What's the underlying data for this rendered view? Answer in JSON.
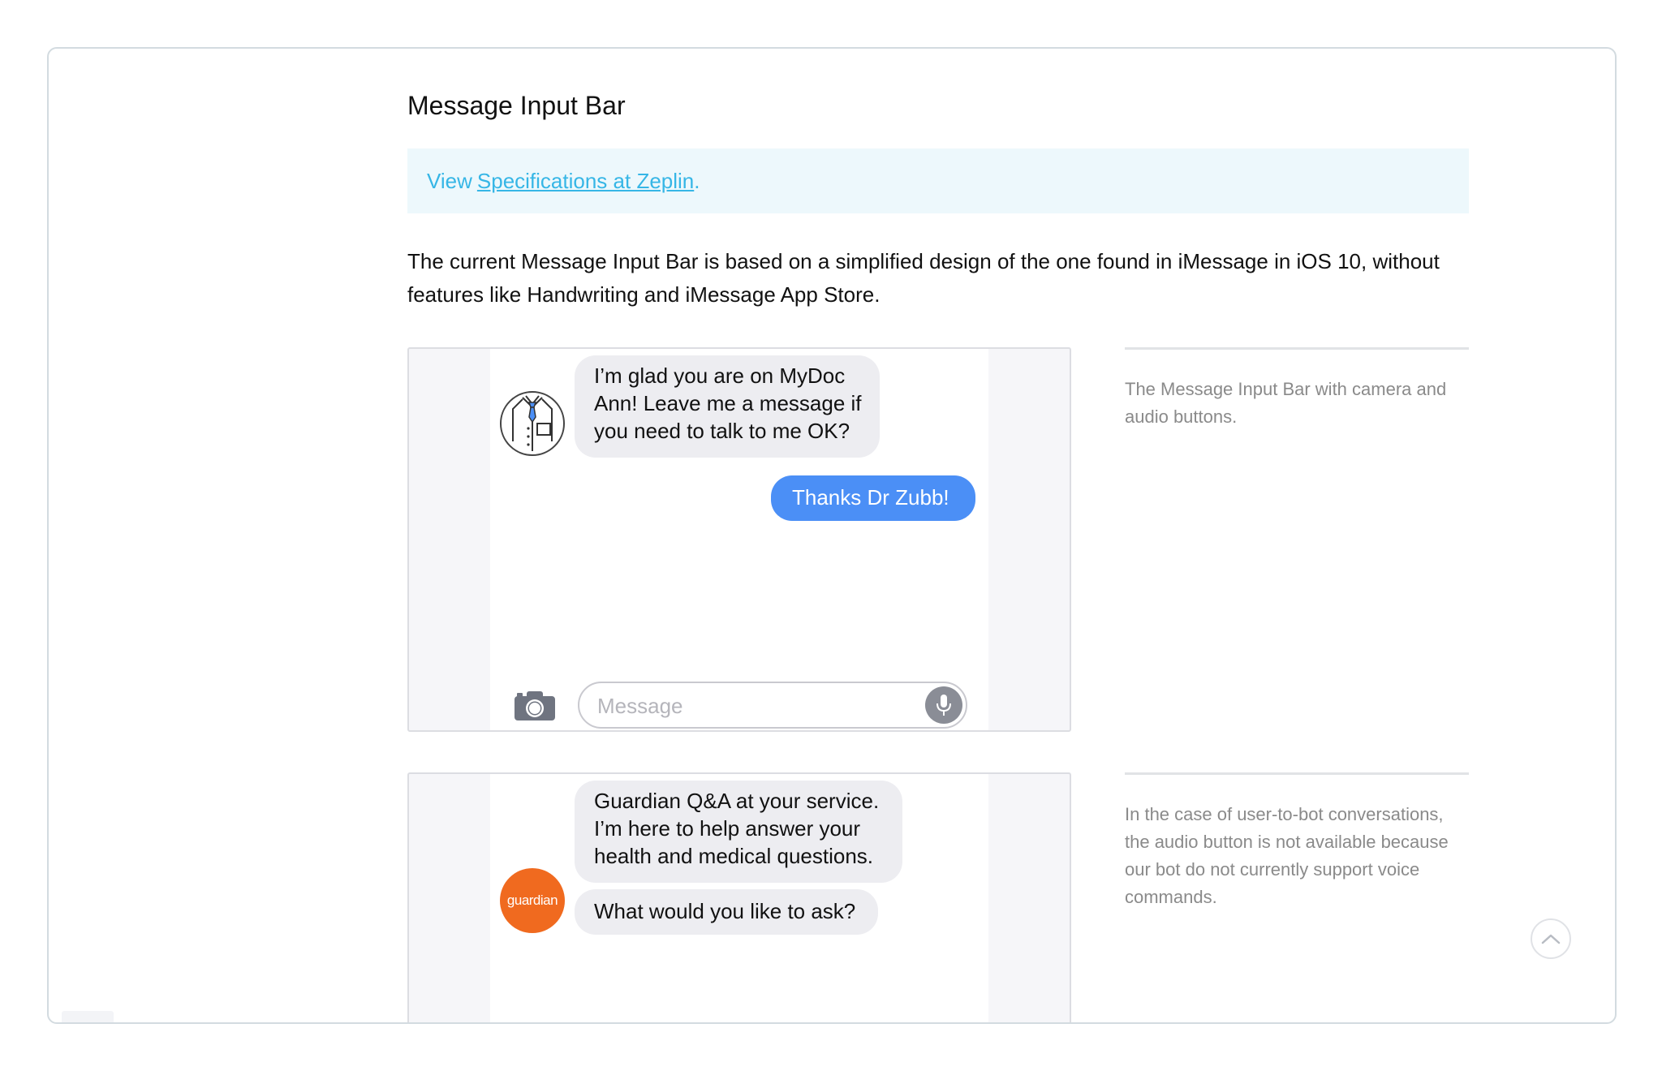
{
  "page": {
    "title": "Message Input Bar",
    "info": {
      "prefix": "View",
      "link_text": "Specifications at Zeplin",
      "suffix": "."
    },
    "intro": "The current Message Input Bar is based on a simplified design of the one found in iMessage in iOS 10, without features like Handwriting and iMessage App Store."
  },
  "demo1": {
    "incoming_lines": [
      "I’m glad you are on MyDoc",
      "Ann! Leave me a message if",
      "you need to talk to me OK?"
    ],
    "outgoing": "Thanks Dr Zubb!",
    "input_placeholder": "Message",
    "icons": {
      "avatar": "doctor-avatar-icon",
      "camera": "camera-icon",
      "mic": "microphone-icon"
    }
  },
  "demo2": {
    "avatar_label": "guardian",
    "incoming1_lines": [
      "Guardian Q&A at your service.",
      "I’m here to help answer your",
      "health and medical questions."
    ],
    "incoming2": "What would you like to ask?"
  },
  "captions": {
    "first": "The Message Input Bar with camera and audio buttons.",
    "second": "In the case of user-to-bot conversations, the audio button is not available because our bot do not currently support voice commands."
  },
  "colors": {
    "accent_link": "#36b6e6",
    "info_background": "#edf8fc",
    "outgoing_bubble": "#4b8ff6",
    "incoming_bubble": "#ededf1",
    "guardian_orange": "#f06a1f"
  }
}
